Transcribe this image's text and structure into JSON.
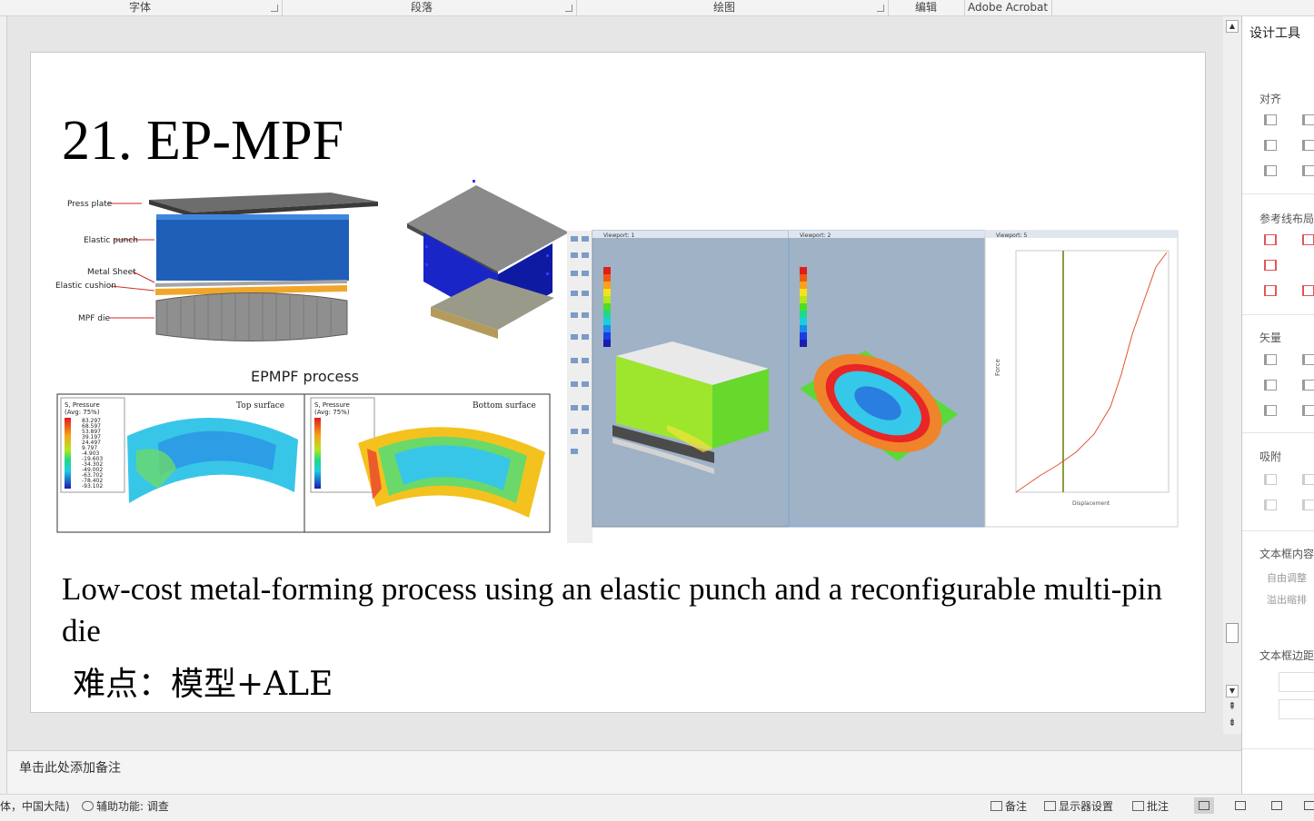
{
  "ribbon": {
    "groups": [
      {
        "label": "字体"
      },
      {
        "label": "段落"
      },
      {
        "label": "绘图"
      },
      {
        "label": "编辑"
      },
      {
        "label": "Adobe Acrobat"
      }
    ]
  },
  "slide": {
    "title": "21. EP-MPF",
    "figure": {
      "press_plate": "Press plate",
      "elastic_punch": "Elastic punch",
      "metal_sheet": "Metal Sheet",
      "elastic_cushion": "Elastic cushion",
      "mpf_die": "MPF die",
      "process_caption": "EPMPF process",
      "legend_title": "S, Pressure",
      "legend_avg": "(Avg: 75%)",
      "legend_values": [
        "83.297",
        "68.597",
        "53.897",
        "39.197",
        "24.497",
        "9.797",
        "-4.903",
        "-19.603",
        "-34.302",
        "-49.002",
        "-63.702",
        "-78.402",
        "-93.102"
      ],
      "top_surface": "Top surface",
      "bottom_surface": "Bottom surface",
      "viewport_1": "Viewport: 1",
      "viewport_2": "Viewport: 2",
      "viewport_5": "Viewport: 5",
      "plot_axis_label": "Force",
      "plot_x_label": "Displacement"
    },
    "description": "Low-cost metal-forming process using an elastic punch and a reconfigurable multi-pin die",
    "difficulty": " 难点：模型+ALE"
  },
  "notes": {
    "placeholder": "单击此处添加备注"
  },
  "right_pane": {
    "title": "设计工具",
    "align": "对齐",
    "guide_layout": "参考线布局",
    "vector": "矢量",
    "snap": "吸附",
    "textbox_content": "文本框内容",
    "auto_adjust": "自由调整",
    "overflow_shrink": "溢出缩排",
    "textbox_margin": "文本框边距"
  },
  "status": {
    "language": "体，中国大陆)",
    "accessibility": "辅助功能: 调查",
    "notes_btn": "备注",
    "display_settings": "显示器设置",
    "comments": "批注"
  },
  "colors": {
    "slide_bg": "#ffffff",
    "app_bg": "#e6e6e6",
    "punch_blue": "#1f5fb8",
    "contour_green": "#5cd93a"
  }
}
